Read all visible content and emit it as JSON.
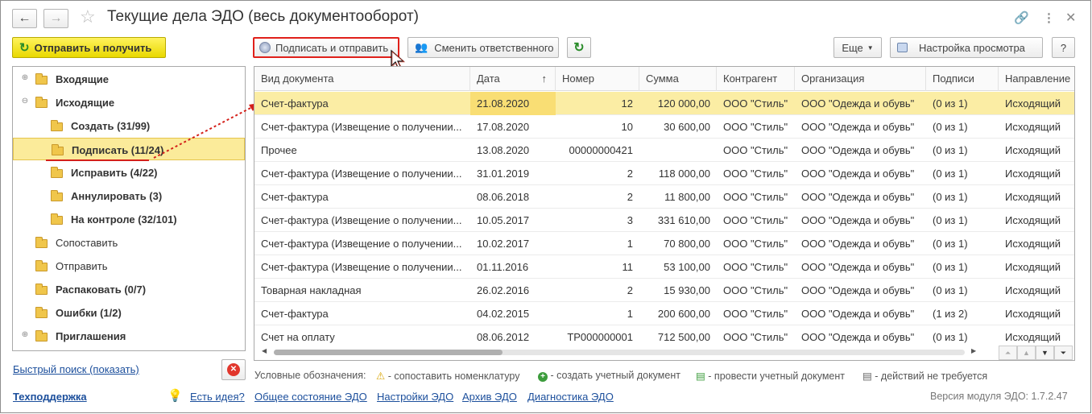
{
  "window": {
    "title": "Текущие дела ЭДО (весь документооборот)"
  },
  "buttons": {
    "send_receive": "Отправить и получить",
    "sign_send": "Подписать и отправить",
    "change_resp": "Сменить ответственного",
    "more": "Еще",
    "view_settings": "Настройка просмотра",
    "help": "?"
  },
  "tree": [
    {
      "label": "Входящие",
      "bold": true,
      "level": 0,
      "expander": "⊕"
    },
    {
      "label": "Исходящие",
      "bold": true,
      "level": 0,
      "expander": "⊖"
    },
    {
      "label": "Создать (31/99)",
      "bold": true,
      "level": 1
    },
    {
      "label": "Подписать (11/24)",
      "bold": true,
      "level": 1,
      "selected": true
    },
    {
      "label": "Исправить (4/22)",
      "bold": true,
      "level": 1
    },
    {
      "label": "Аннулировать (3)",
      "bold": true,
      "level": 1
    },
    {
      "label": "На контроле (32/101)",
      "bold": true,
      "level": 1
    },
    {
      "label": "Сопоставить",
      "bold": false,
      "level": 0
    },
    {
      "label": "Отправить",
      "bold": false,
      "level": 0
    },
    {
      "label": "Распаковать (0/7)",
      "bold": true,
      "level": 0
    },
    {
      "label": "Ошибки (1/2)",
      "bold": true,
      "level": 0
    },
    {
      "label": "Приглашения",
      "bold": true,
      "level": 0,
      "expander": "⊕"
    }
  ],
  "grid": {
    "columns": [
      "Вид документа",
      "Дата",
      "Номер",
      "Сумма",
      "Контрагент",
      "Организация",
      "Подписи",
      "Направление"
    ],
    "rows": [
      [
        "Счет-фактура",
        "21.08.2020",
        "12",
        "120 000,00",
        "ООО \"Стиль\"",
        "ООО \"Одежда и обувь\"",
        "(0 из 1)",
        "Исходящий"
      ],
      [
        "Счет-фактура (Извещение о получении...",
        "17.08.2020",
        "10",
        "30 600,00",
        "ООО \"Стиль\"",
        "ООО \"Одежда и обувь\"",
        "(0 из 1)",
        "Исходящий"
      ],
      [
        "Прочее",
        "13.08.2020",
        "00000000421",
        "",
        "ООО \"Стиль\"",
        "ООО \"Одежда и обувь\"",
        "(0 из 1)",
        "Исходящий"
      ],
      [
        "Счет-фактура (Извещение о получении...",
        "31.01.2019",
        "2",
        "118 000,00",
        "ООО \"Стиль\"",
        "ООО \"Одежда и обувь\"",
        "(0 из 1)",
        "Исходящий"
      ],
      [
        "Счет-фактура",
        "08.06.2018",
        "2",
        "11 800,00",
        "ООО \"Стиль\"",
        "ООО \"Одежда и обувь\"",
        "(0 из 1)",
        "Исходящий"
      ],
      [
        "Счет-фактура (Извещение о получении...",
        "10.05.2017",
        "3",
        "331 610,00",
        "ООО \"Стиль\"",
        "ООО \"Одежда и обувь\"",
        "(0 из 1)",
        "Исходящий"
      ],
      [
        "Счет-фактура (Извещение о получении...",
        "10.02.2017",
        "1",
        "70 800,00",
        "ООО \"Стиль\"",
        "ООО \"Одежда и обувь\"",
        "(0 из 1)",
        "Исходящий"
      ],
      [
        "Счет-фактура (Извещение о получении...",
        "01.11.2016",
        "11",
        "53 100,00",
        "ООО \"Стиль\"",
        "ООО \"Одежда и обувь\"",
        "(0 из 1)",
        "Исходящий"
      ],
      [
        "Товарная накладная",
        "26.02.2016",
        "2",
        "15 930,00",
        "ООО \"Стиль\"",
        "ООО \"Одежда и обувь\"",
        "(0 из 1)",
        "Исходящий"
      ],
      [
        "Счет-фактура",
        "04.02.2015",
        "1",
        "200 600,00",
        "ООО \"Стиль\"",
        "ООО \"Одежда и обувь\"",
        "(1 из 2)",
        "Исходящий"
      ],
      [
        "Счет на оплату",
        "08.06.2012",
        "ТР000000001",
        "712 500,00",
        "ООО \"Стиль\"",
        "ООО \"Одежда и обувь\"",
        "(0 из 1)",
        "Исходящий"
      ]
    ]
  },
  "quick_search": "Быстрый поиск (показать)",
  "legend": {
    "label": "Условные обозначения:",
    "warn": "- сопоставить номенклатуру",
    "create": "- создать учетный документ",
    "post": "- провести учетный документ",
    "none": "- действий не требуется"
  },
  "footer": {
    "support": "Техподдержка",
    "idea": "Есть идея?",
    "state": "Общее состояние ЭДО",
    "settings": "Настройки ЭДО",
    "archive": "Архив ЭДО",
    "diag": "Диагностика ЭДО",
    "version": "Версия модуля ЭДО: 1.7.2.47"
  },
  "colors": {
    "accent_yellow": "#f2e21c",
    "selection": "#fbeda4",
    "link": "#1c4f9c",
    "highlight_red": "#e0201a"
  }
}
